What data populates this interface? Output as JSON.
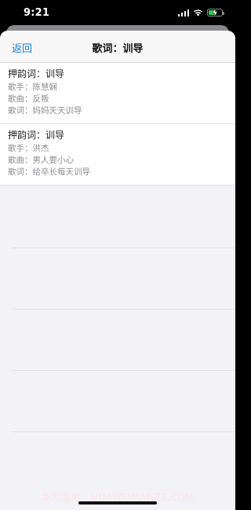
{
  "status_bar": {
    "time": "9:21",
    "battery_level": 0.6,
    "battery_color": "#34c759",
    "icons": [
      "cellular-signal-icon",
      "wifi-icon",
      "battery-charging-icon"
    ]
  },
  "nav": {
    "back_label": "返回",
    "title": "歌词：训导"
  },
  "results": [
    {
      "title": "押韵词：训导",
      "singer": "歌手：陈慧娴",
      "song": "歌曲：反叛",
      "lyric": "歌词：妈妈天天训导"
    },
    {
      "title": "押韵词：训导",
      "singer": "歌手：洪杰",
      "song": "歌曲：男人要小心",
      "lyric": "歌词：给卒长每天训导"
    }
  ],
  "watermark": "华为应用 · HUAWEIMANZS.COM",
  "colors": {
    "accent": "#1a7fd4",
    "secondary_text": "#8e8e93",
    "background": "#f2f2f7"
  }
}
